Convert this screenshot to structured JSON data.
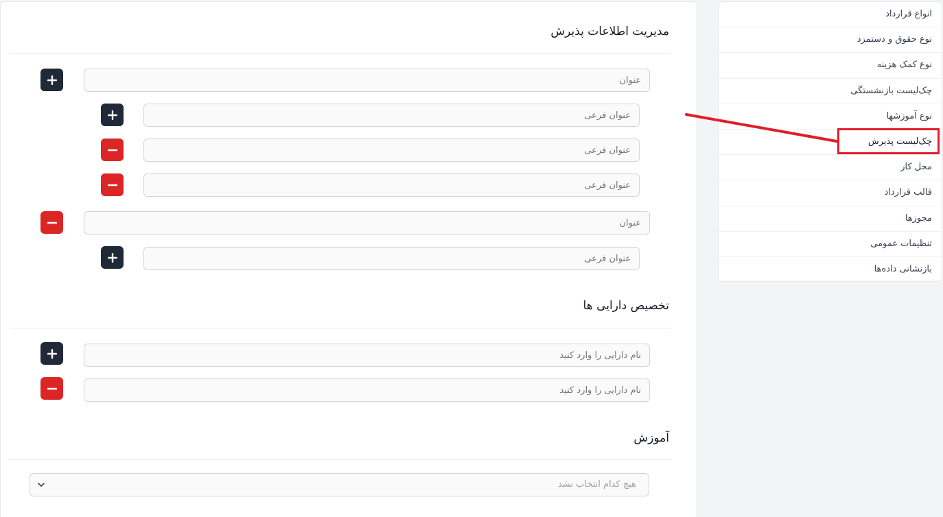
{
  "admission": {
    "title": "مدیریت اطلاعات پذیرش",
    "title_placeholder": "عنوان",
    "subtitle_placeholder": "عنوان فرعی"
  },
  "assets": {
    "title": "تخصیص دارایی ها",
    "asset_placeholder": "نام دارایی را وارد کنید"
  },
  "training": {
    "title": "آموزش",
    "select_value": "هیچ کدام انتخاب نشد"
  },
  "menu": {
    "items": [
      "انواع قرارداد",
      "نوع حقوق و دستمزد",
      "نوع کمک هزینه",
      "چک‌لیست بازنشستگی",
      "نوع آموزشها",
      "چک‌لیست پذیرش",
      "محل کار",
      "قالب قرارداد",
      "مجوزها",
      "تنظیمات عمومی",
      "بازنشانی داده‌ها"
    ],
    "selected_index": 5
  },
  "colors": {
    "dark_button": "#1f2937",
    "remove_button": "#dc2626",
    "highlight": "#e11d2a"
  },
  "icons": {
    "add": "plus-icon",
    "remove": "minus-icon",
    "select": "chevron-down-icon"
  }
}
